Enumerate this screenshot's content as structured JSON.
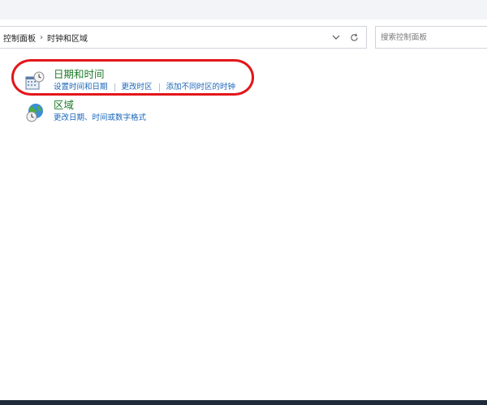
{
  "breadcrumb": {
    "root": "控制面板",
    "separator": "›",
    "current": "时钟和区域"
  },
  "address_bar": {
    "dropdown_icon": "chevron-down-icon",
    "refresh_icon": "refresh-icon"
  },
  "search": {
    "placeholder": "搜索控制面板",
    "value": ""
  },
  "items": [
    {
      "title": "日期和时间",
      "icon": "calendar-clock-icon",
      "links": [
        "设置时间和日期",
        "更改时区",
        "添加不同时区的时钟"
      ]
    },
    {
      "title": "区域",
      "icon": "globe-clock-icon",
      "links": [
        "更改日期、时间或数字格式"
      ]
    }
  ],
  "colors": {
    "item_title": "#1e7b2a",
    "link": "#1a66b8",
    "highlight": "#e3161a"
  }
}
